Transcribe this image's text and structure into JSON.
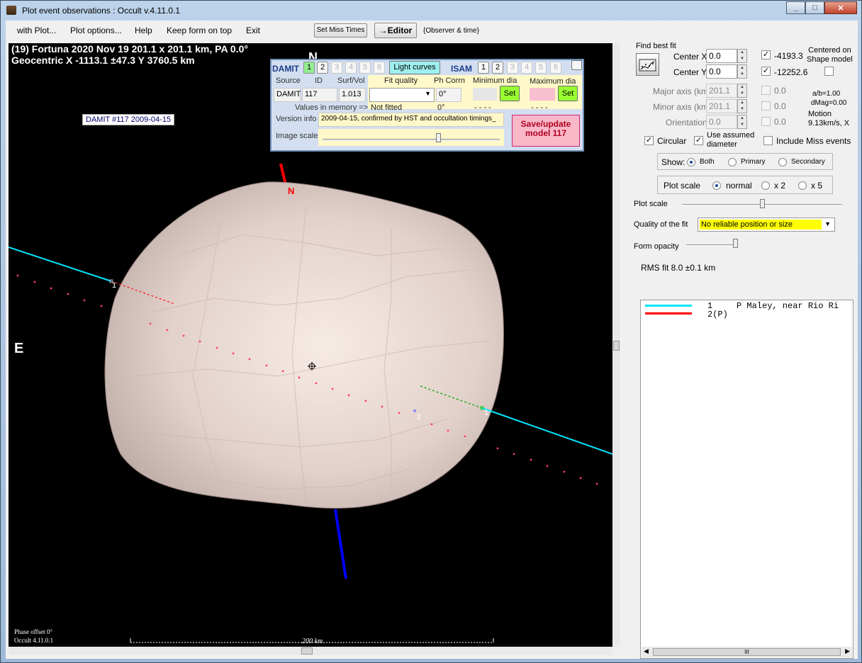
{
  "window": {
    "title": "Plot event observations : Occult v.4.11.0.1",
    "minimize": "_",
    "maximize": "□",
    "close": "✕"
  },
  "menu": {
    "with_plot": "with Plot...",
    "plot_options": "Plot options...",
    "help": "Help",
    "keep_on_top": "Keep form on top",
    "exit": "Exit",
    "set_miss_times": "Set Miss Times",
    "editor": "→Editor",
    "observer_time": "{Observer & time}"
  },
  "plot": {
    "header_line1": "(19) Fortuna  2020 Nov 19   201.1 x 201.1 km, PA 0.0°",
    "header_line2": "Geocentric  X  -1113.1 ±47.3  Y 3760.5 km",
    "north": "N",
    "north_marker": "N",
    "east": "E",
    "damit_label": "DAMIT #117 2009-04-15",
    "chord1_label": "1",
    "chord2_label": "2",
    "chord1_label_right": "1",
    "phase_offset": "Phase offset 0°",
    "version": "Occult 4.11.0.1",
    "scale_label": "200 km"
  },
  "damit_panel": {
    "damit_title": "DAMIT",
    "damit_buttons": [
      "1",
      "2",
      "3",
      "4",
      "5",
      "6"
    ],
    "light_curves": "Light curves",
    "isam_title": "ISAM",
    "isam_buttons": [
      "1",
      "2",
      "3",
      "4",
      "5",
      "6"
    ],
    "source_label": "Source",
    "id_label": "ID",
    "surf_vol_label": "Surf/Vol",
    "source_value": "DAMIT",
    "id_value": "117",
    "surf_vol_value": "1.013",
    "values_in_memory": "Values in memory =>",
    "fit_quality_label": "Fit quality",
    "fit_quality_value": "Not fitted",
    "ph_corr_label": "Ph Corrn",
    "ph_corr_value": "0°",
    "ph_corr_memory": "0°",
    "min_dia_label": "Minimum dia",
    "min_dia_memory": "- - - -",
    "max_dia_label": "Maximum dia",
    "max_dia_memory": "- - - -",
    "set": "Set",
    "version_info_label": "Version info",
    "version_info_value": "2009-04-15, confirmed by HST and occultation timings_",
    "image_scale_label": "Image scale",
    "save_button": "Save/update\nmodel 117"
  },
  "right_panel": {
    "find_best_fit": "Find best fit",
    "center_x_label": "Center X",
    "center_x_value": "0.0",
    "center_x_result": "-4193.3",
    "center_y_label": "Center Y",
    "center_y_value": "0.0",
    "center_y_result": "-12252.6",
    "centered_shape": "Centered on\nShape model",
    "major_axis_label": "Major axis (km)",
    "major_axis_value": "201.1",
    "major_axis_result": "0.0",
    "minor_axis_label": "Minor axis (km)",
    "minor_axis_value": "201.1",
    "minor_axis_result": "0.0",
    "orientation_label": "Orientation",
    "orientation_value": "0.0",
    "orientation_result": "0.0",
    "ab_ratio": "a/b=1.00",
    "dmag": "dMag=0.00",
    "motion": "Motion\n9.13km/s, X",
    "circular": "Circular",
    "use_assumed_diameter": "Use assumed\ndiameter",
    "include_miss_events": "Include Miss events",
    "show_label": "Show:",
    "show_both": "Both",
    "show_primary": "Primary",
    "show_secondary": "Secondary",
    "plot_scale_group": "Plot scale",
    "scale_normal": "normal",
    "scale_x2": "x 2",
    "scale_x5": "x 5",
    "plot_scale_slider": "Plot scale",
    "quality_label": "Quality of the fit",
    "quality_value": "No reliable position or size",
    "form_opacity": "Form opacity",
    "rms_fit": "RMS fit 8.0 ±0.1 km",
    "results": [
      {
        "num": "1",
        "text": "P Maley, near Rio Ri",
        "color": "#00e5ff"
      },
      {
        "num": "2(P)",
        "text": "",
        "color": "#ff0000"
      }
    ],
    "scroll_grip": "III"
  },
  "colors": {
    "asteroid": "#e5d5ce",
    "chord_cyan": "#00e5ff",
    "chord_red": "#ff3030",
    "north_axis": "#ff0000",
    "south_axis": "#0000ff",
    "quality_bg": "#ffff00"
  }
}
